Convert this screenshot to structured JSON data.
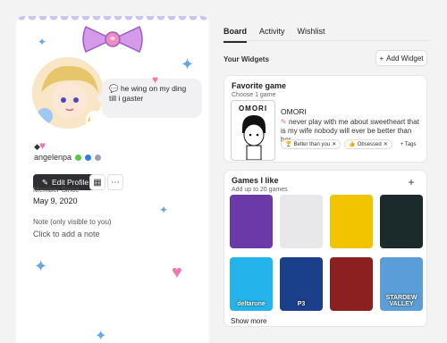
{
  "profile": {
    "status_text": "he wing on my ding till i gaster",
    "name_glyph": "◆",
    "username": "angelenpa",
    "edit_label": "Edit Profile",
    "member_since_label": "Member Since",
    "member_since_value": "May 9, 2020",
    "note_label": "Note (only visible to you)",
    "note_placeholder": "Click to add a note"
  },
  "tabs": [
    "Board",
    "Activity",
    "Wishlist"
  ],
  "widgets": {
    "heading": "Your Widgets",
    "add_label": "Add Widget"
  },
  "favorite_game": {
    "title": "Favorite game",
    "subtitle": "Choose 1 game",
    "cover_text": "OMORI",
    "game_name": "OMORI",
    "description": "never play with me about sweetheart that is my wife nobody will ever be better than her.",
    "tags": [
      "Better than you",
      "Obsessed",
      "+ Tags"
    ]
  },
  "games_i_like": {
    "title": "Games I like",
    "subtitle": "Add up to 20 games",
    "covers": [
      {
        "label": "",
        "color": "#6c3aa8"
      },
      {
        "label": "",
        "color": "#e8e8ea"
      },
      {
        "label": "",
        "color": "#f2c400"
      },
      {
        "label": "",
        "color": "#1b2a2a"
      },
      {
        "label": "deltarune",
        "color": "#23b4ec"
      },
      {
        "label": "P3",
        "color": "#1b3f8a"
      },
      {
        "label": "",
        "color": "#8c1f1f"
      },
      {
        "label": "STARDEW VALLEY",
        "color": "#5b9ed7"
      }
    ],
    "show_more_label": "Show more"
  },
  "colors": {
    "accent_dark": "#2f2f33",
    "bow_pink": "#ce8be5",
    "sparkle_blue": "#6aa6e6",
    "heart_pink": "#ee79ae"
  }
}
